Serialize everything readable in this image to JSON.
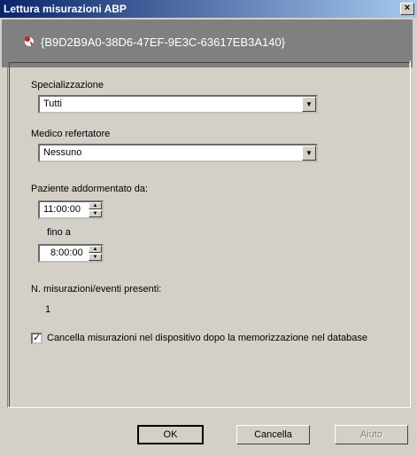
{
  "window": {
    "title": "Lettura misurazioni ABP",
    "close_label": "×"
  },
  "header": {
    "guid": "{B9D2B9A0-38D6-47EF-9E3C-63617EB3A140}"
  },
  "form": {
    "specializzazione": {
      "label": "Specializzazione",
      "value": "Tutti"
    },
    "medico": {
      "label": "Medico refertatore",
      "value": "Nessuno"
    },
    "paziente": {
      "label": "Paziente addormentato da:",
      "from_value": "11:00:00",
      "to_label": "fino a",
      "to_value": "8:00:00"
    },
    "misurazioni": {
      "label": "N. misurazioni/eventi presenti:",
      "count": "1"
    },
    "cancella_checkbox": {
      "checked": true,
      "mark": "✓",
      "label": "Cancella misurazioni nel dispositivo dopo la memorizzazione nel database"
    }
  },
  "buttons": {
    "ok": "OK",
    "cancel": "Cancella",
    "help": "Aiuto"
  },
  "colors": {
    "titlebar_start": "#0a246a",
    "titlebar_end": "#a6caf0",
    "dialog_bg": "#d4d0c8"
  }
}
